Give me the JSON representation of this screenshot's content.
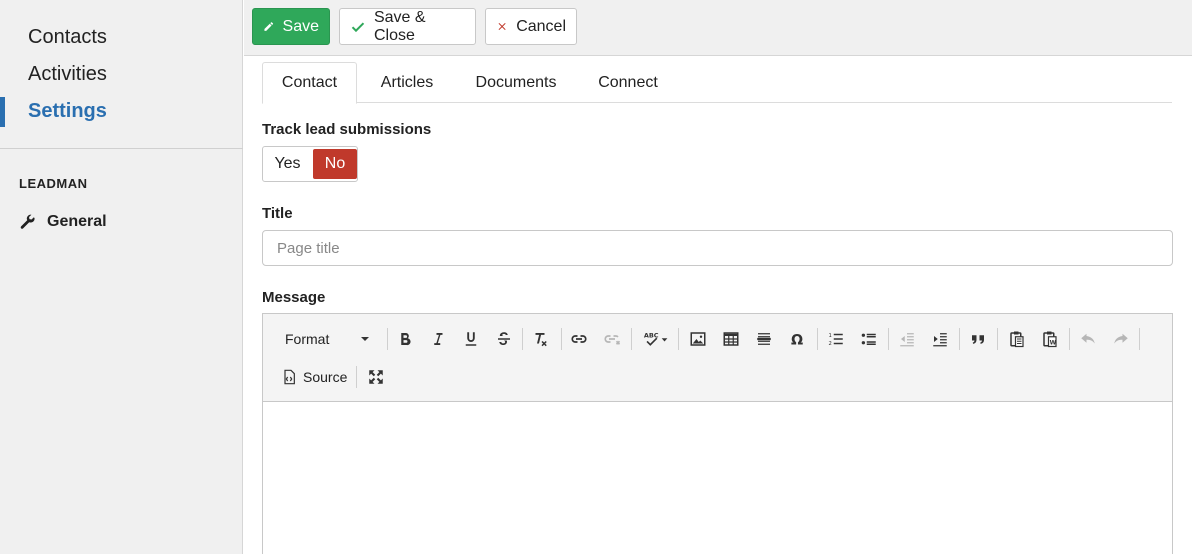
{
  "sidebar": {
    "items": [
      {
        "label": "Contacts"
      },
      {
        "label": "Activities"
      },
      {
        "label": "Settings",
        "active": true
      }
    ],
    "section_title": "LEADMAN",
    "general": {
      "label": "General",
      "icon": "wrench-icon"
    }
  },
  "toolbar": {
    "save_label": "Save",
    "save_close_label": "Save & Close",
    "cancel_label": "Cancel"
  },
  "tabs": [
    {
      "label": "Contact",
      "active": true
    },
    {
      "label": "Articles"
    },
    {
      "label": "Documents"
    },
    {
      "label": "Connect"
    }
  ],
  "form": {
    "track_label": "Track lead submissions",
    "toggle": {
      "yes": "Yes",
      "no": "No",
      "selected": "No"
    },
    "title_label": "Title",
    "title_placeholder": "Page title",
    "title_value": "",
    "message_label": "Message"
  },
  "editor": {
    "format_label": "Format",
    "source_label": "Source"
  },
  "colors": {
    "accent": "#2a6fb0",
    "save_green": "#2fa85a",
    "no_red": "#c0392b",
    "check_green": "#2fa85a",
    "cancel_red": "#c0392b"
  }
}
